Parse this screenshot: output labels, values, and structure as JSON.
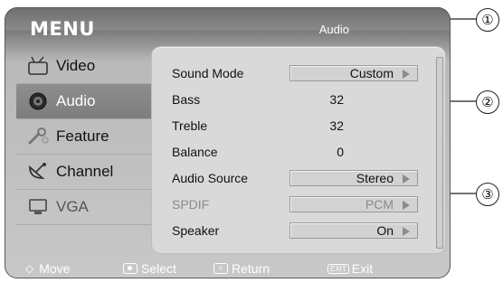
{
  "menu": {
    "title": "MENU",
    "section": "Audio",
    "sidebar": [
      {
        "label": "Video",
        "icon": "tv-icon",
        "selected": false
      },
      {
        "label": "Audio",
        "icon": "speaker-icon",
        "selected": true
      },
      {
        "label": "Feature",
        "icon": "gear-icon",
        "selected": false
      },
      {
        "label": "Channel",
        "icon": "satellite-icon",
        "selected": false
      },
      {
        "label": "VGA",
        "icon": "monitor-icon",
        "selected": false
      }
    ],
    "rows": [
      {
        "name": "Sound Mode",
        "value": "Custom"
      },
      {
        "name": "Bass",
        "value": "32"
      },
      {
        "name": "Treble",
        "value": "32"
      },
      {
        "name": "Balance",
        "value": "0"
      },
      {
        "name": "Audio Source",
        "value": "Stereo"
      },
      {
        "name": "SPDIF",
        "value": "PCM"
      },
      {
        "name": "Speaker",
        "value": "On"
      }
    ]
  },
  "footer": {
    "move": "Move",
    "select": "Select",
    "return": "Return",
    "exit_badge": "EXIT",
    "exit": "Exit"
  },
  "callouts": [
    "①",
    "②",
    "③"
  ]
}
